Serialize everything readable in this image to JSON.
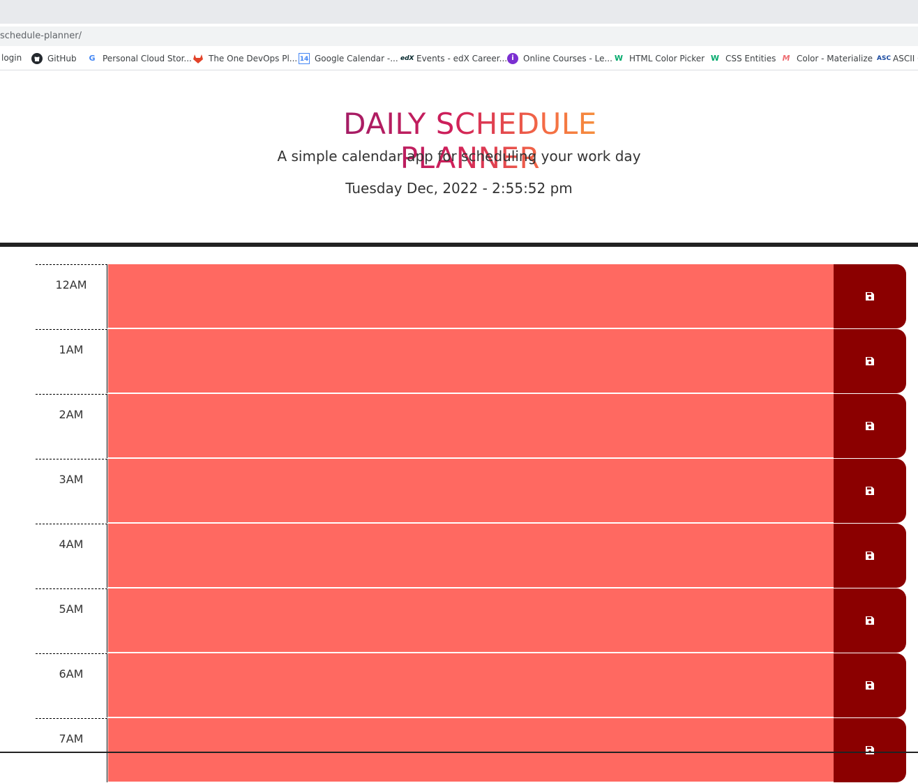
{
  "browser": {
    "url": "schedule-planner/",
    "bookmarks": [
      {
        "label": "login",
        "icon": "none"
      },
      {
        "label": "GitHub",
        "icon": "github-icon"
      },
      {
        "label": "Personal Cloud Stor...",
        "icon": "google-icon"
      },
      {
        "label": "The One DevOps Pl...",
        "icon": "gitlab-icon"
      },
      {
        "label": "Google Calendar -...",
        "icon": "calendar-icon"
      },
      {
        "label": "Events - edX Career...",
        "icon": "edx-icon"
      },
      {
        "label": "Online Courses - Le...",
        "icon": "courses-icon"
      },
      {
        "label": "HTML Color Picker",
        "icon": "w3-icon"
      },
      {
        "label": "CSS Entities",
        "icon": "w3-icon"
      },
      {
        "label": "Color - Materialize",
        "icon": "materialize-icon"
      },
      {
        "label": "ASCII C",
        "icon": "ascii-icon"
      }
    ]
  },
  "header": {
    "title": "DAILY SCHEDULE PLANNER",
    "lead": "A simple calendar app for scheduling your work day",
    "current_day": "Tuesday Dec, 2022 - 2:55:52 pm"
  },
  "colors": {
    "past_slot": "#ff6961",
    "save_button": "#8b0000",
    "title_gradient": [
      "#8b1a6b",
      "#cf1f5a",
      "#f46b45",
      "#f7b733"
    ]
  },
  "time_blocks": [
    {
      "hour": "12AM",
      "text": "",
      "state": "past"
    },
    {
      "hour": "1AM",
      "text": "",
      "state": "past"
    },
    {
      "hour": "2AM",
      "text": "",
      "state": "past"
    },
    {
      "hour": "3AM",
      "text": "",
      "state": "past"
    },
    {
      "hour": "4AM",
      "text": "",
      "state": "past"
    },
    {
      "hour": "5AM",
      "text": "",
      "state": "past"
    },
    {
      "hour": "6AM",
      "text": "",
      "state": "past"
    },
    {
      "hour": "7AM",
      "text": "",
      "state": "past"
    }
  ]
}
